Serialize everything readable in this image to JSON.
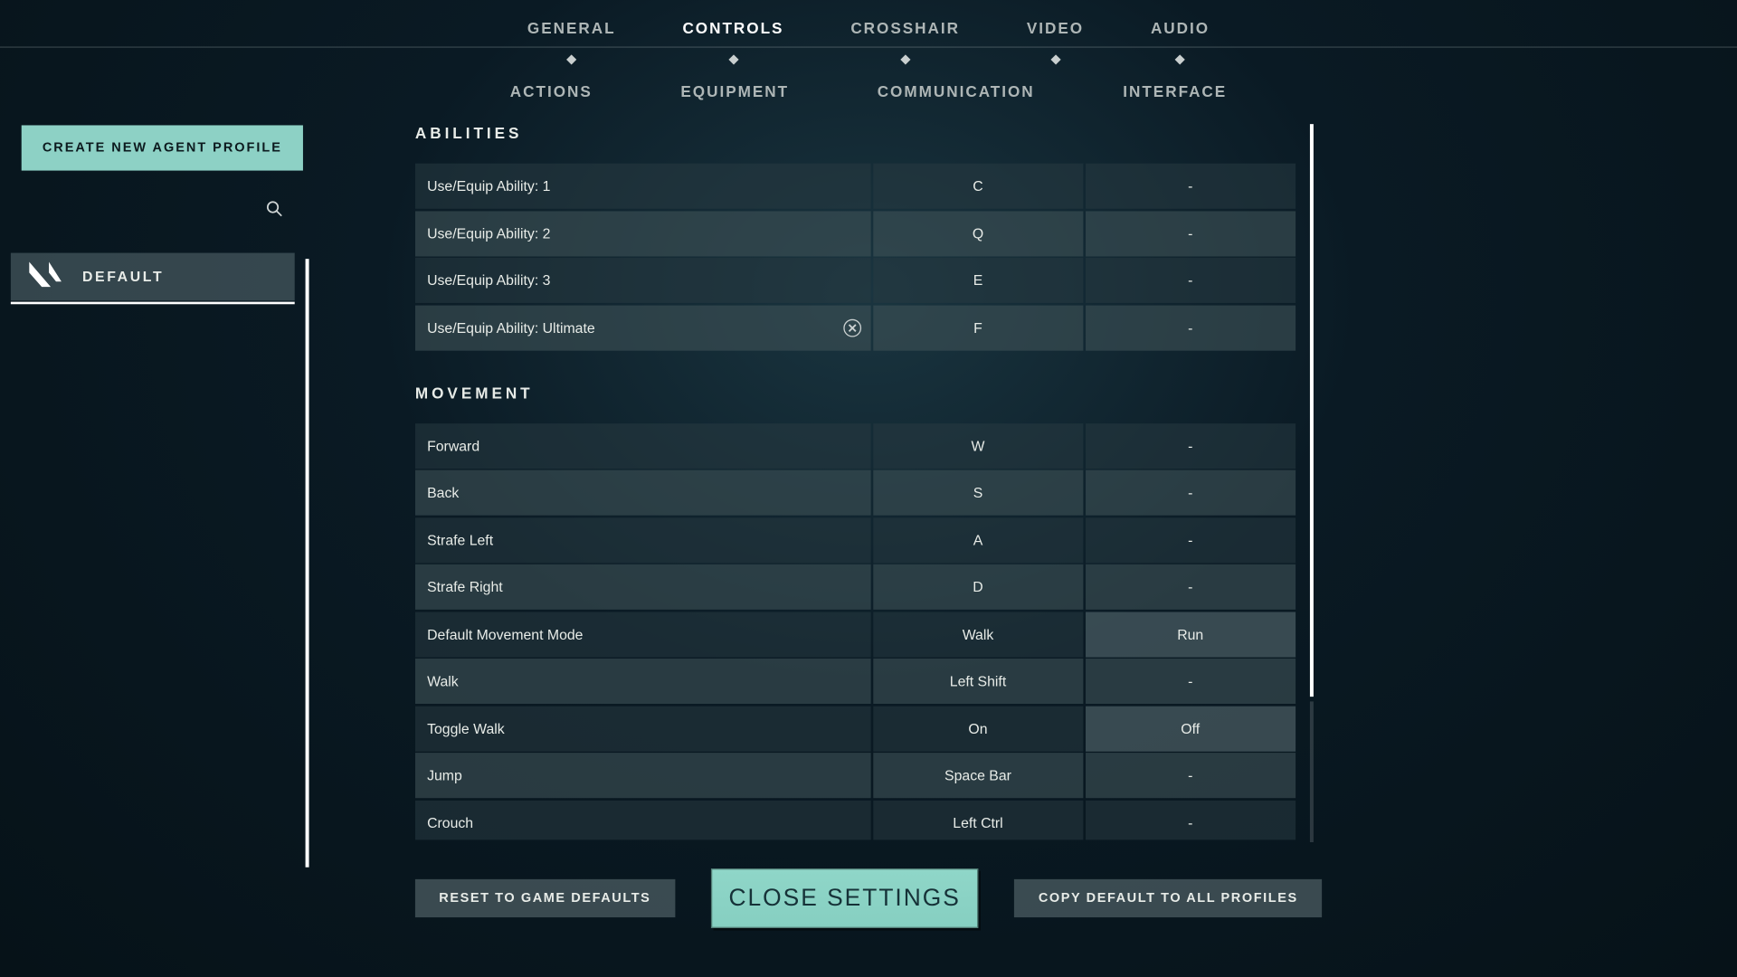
{
  "topTabs": [
    "GENERAL",
    "CONTROLS",
    "CROSSHAIR",
    "VIDEO",
    "AUDIO"
  ],
  "topActiveIndex": 1,
  "subTabs": [
    "ACTIONS",
    "EQUIPMENT",
    "COMMUNICATION",
    "INTERFACE"
  ],
  "sidebar": {
    "createLabel": "CREATE NEW AGENT PROFILE",
    "profileLabel": "DEFAULT"
  },
  "sections": [
    {
      "title": "ABILITIES",
      "rows": [
        {
          "label": "Use/Equip Ability: 1",
          "type": "bind",
          "primary": "C",
          "secondary": "-",
          "hasReset": false,
          "accent": false
        },
        {
          "label": "Use/Equip Ability: 2",
          "type": "bind",
          "primary": "Q",
          "secondary": "-",
          "hasReset": false,
          "accent": true
        },
        {
          "label": "Use/Equip Ability: 3",
          "type": "bind",
          "primary": "E",
          "secondary": "-",
          "hasReset": false,
          "accent": false
        },
        {
          "label": "Use/Equip Ability: Ultimate",
          "type": "bind",
          "primary": "F",
          "secondary": "-",
          "hasReset": true,
          "accent": true
        }
      ]
    },
    {
      "title": "MOVEMENT",
      "rows": [
        {
          "label": "Forward",
          "type": "bind",
          "primary": "W",
          "secondary": "-",
          "accent": false
        },
        {
          "label": "Back",
          "type": "bind",
          "primary": "S",
          "secondary": "-",
          "accent": true
        },
        {
          "label": "Strafe Left",
          "type": "bind",
          "primary": "A",
          "secondary": "-",
          "accent": false
        },
        {
          "label": "Strafe Right",
          "type": "bind",
          "primary": "D",
          "secondary": "-",
          "accent": true
        },
        {
          "label": "Default Movement Mode",
          "type": "toggle",
          "primary": "Walk",
          "secondary": "Run",
          "accent": false
        },
        {
          "label": "Walk",
          "type": "bind",
          "primary": "Left Shift",
          "secondary": "-",
          "accent": true
        },
        {
          "label": "Toggle Walk",
          "type": "toggle",
          "primary": "On",
          "secondary": "Off",
          "accent": false
        },
        {
          "label": "Jump",
          "type": "bind",
          "primary": "Space Bar",
          "secondary": "-",
          "accent": true
        },
        {
          "label": "Crouch",
          "type": "bind",
          "primary": "Left Ctrl",
          "secondary": "-",
          "accent": false
        }
      ]
    }
  ],
  "footer": {
    "reset": "RESET TO GAME DEFAULTS",
    "close": "CLOSE SETTINGS",
    "copy": "COPY DEFAULT TO ALL PROFILES"
  }
}
